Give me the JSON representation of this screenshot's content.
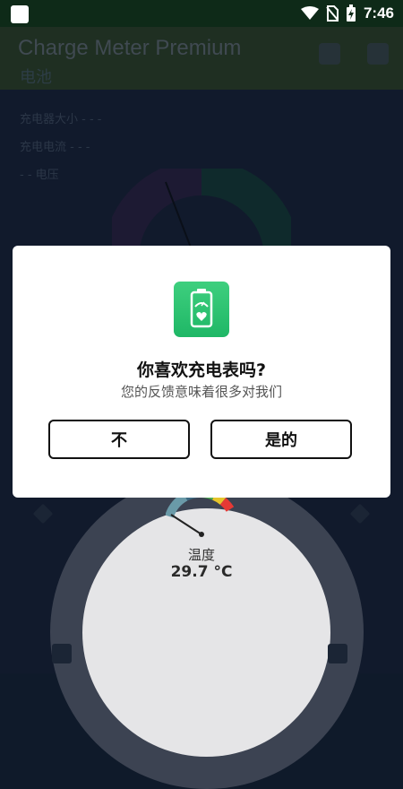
{
  "status_bar": {
    "time": "7:46"
  },
  "app": {
    "title": "Charge Meter Premium",
    "subtitle": "电池",
    "info_lines": [
      "充电器大小 - - -",
      "充电电流 - - -",
      "- - 电压"
    ]
  },
  "temperature": {
    "label": "温度",
    "value": "29.7 °C"
  },
  "dialog": {
    "title": "你喜欢充电表吗?",
    "subtitle": "您的反馈意味着很多对我们",
    "no_label": "不",
    "yes_label": "是的"
  },
  "colors": {
    "accent_green": "#27c36e",
    "dialog_bg": "#ffffff",
    "status_bg": "#0e2a18"
  }
}
